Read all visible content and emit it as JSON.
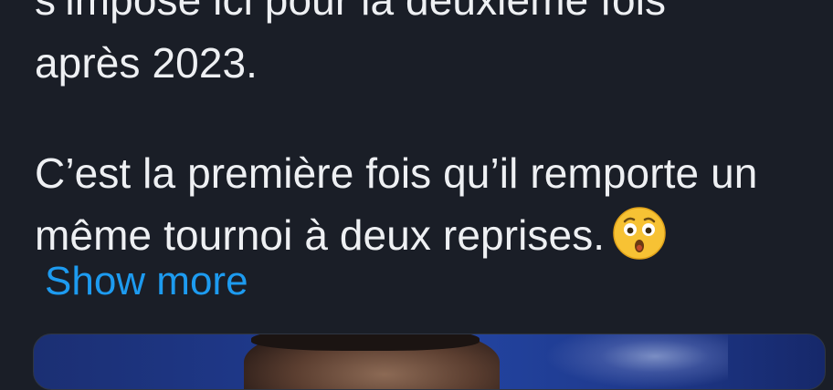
{
  "tweet": {
    "lines": [
      "s’impose ici pour la deuxième fois",
      "après 2023.",
      "C’est la première fois qu’il remporte un",
      "même tournoi à deux reprises."
    ],
    "emoji": "astonished-face",
    "show_more": "Show more"
  },
  "colors": {
    "background": "#1a1e27",
    "text": "#eef0f3",
    "link": "#1d9bf0"
  }
}
